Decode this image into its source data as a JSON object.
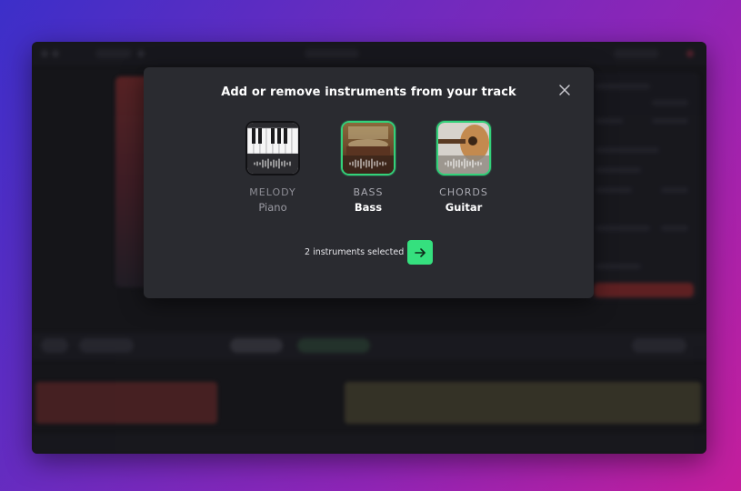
{
  "modal": {
    "title": "Add or remove instruments from your track",
    "close_icon": "close-icon"
  },
  "instruments": [
    {
      "category": "MELODY",
      "name": "Piano",
      "selected": false,
      "icon": "piano-icon"
    },
    {
      "category": "BASS",
      "name": "Bass",
      "selected": true,
      "icon": "bass-icon"
    },
    {
      "category": "CHORDS",
      "name": "Guitar",
      "selected": true,
      "icon": "guitar-icon"
    }
  ],
  "footer": {
    "status": "2 instruments selected",
    "next_icon": "arrow-right-icon"
  },
  "colors": {
    "accent": "#35e07e",
    "modal_bg": "#2a2b30",
    "selected_border": "#33d17a"
  }
}
